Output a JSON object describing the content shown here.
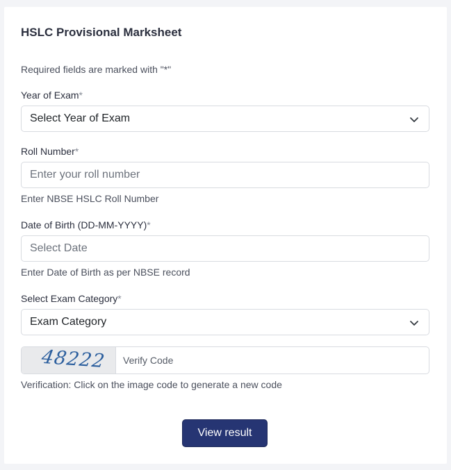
{
  "form": {
    "title": "HSLC Provisional Marksheet",
    "required_note": "Required fields are marked with \"*\"",
    "year": {
      "label": "Year of Exam",
      "required_mark": "*",
      "selected": "Select Year of Exam"
    },
    "roll": {
      "label": "Roll Number",
      "required_mark": "*",
      "placeholder": "Enter your roll number",
      "help": "Enter NBSE HSLC Roll Number"
    },
    "dob": {
      "label": "Date of Birth (DD-MM-YYYY)",
      "required_mark": "*",
      "placeholder": "Select Date",
      "help": "Enter Date of Birth as per NBSE record"
    },
    "category": {
      "label": "Select Exam Category",
      "required_mark": "*",
      "selected": "Exam Category"
    },
    "captcha": {
      "code": "48222",
      "placeholder": "Verify Code",
      "help": "Verification: Click on the image code to generate a new code"
    },
    "submit_label": "View result"
  },
  "icons": {
    "select_arrow": "chevron-down-icon"
  },
  "colors": {
    "primary_button": "#263573",
    "captcha_text": "#2c5f9e",
    "page_background": "#f3f4f7"
  }
}
